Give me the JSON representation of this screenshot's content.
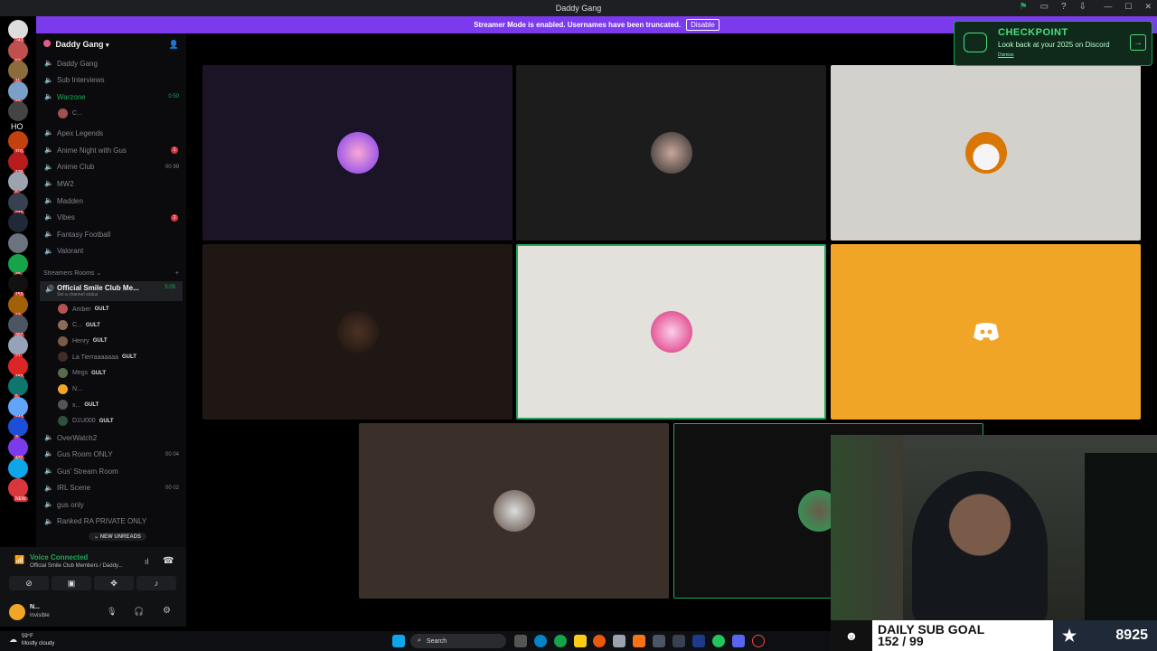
{
  "titlebar": {
    "title": "Daddy Gang"
  },
  "banner": {
    "text": "Streamer Mode is enabled. Usernames have been truncated.",
    "button": "Disable"
  },
  "servers": [
    {
      "badge": "243"
    },
    {
      "badge": "52"
    },
    {
      "badge": "11"
    },
    {
      "badge": "32"
    },
    {
      "badge": ""
    },
    {
      "badge": "110"
    },
    {
      "badge": "176"
    },
    {
      "badge": "6"
    },
    {
      "badge": "242"
    },
    {
      "badge": ""
    },
    {
      "badge": ""
    },
    {
      "badge": "49"
    },
    {
      "badge": "153"
    },
    {
      "badge": "13"
    },
    {
      "badge": "307"
    },
    {
      "badge": "21"
    },
    {
      "badge": "182"
    },
    {
      "badge": "5"
    },
    {
      "badge": "347"
    },
    {
      "badge": "3"
    },
    {
      "badge": "437"
    },
    {
      "badge": ""
    },
    {
      "badge": "NEW"
    }
  ],
  "home_label": "HO",
  "guild": {
    "name": "Daddy Gang"
  },
  "channels_top": [
    {
      "name": "Daddy Gang",
      "right": ""
    },
    {
      "name": "Sub Interviews",
      "right": ""
    },
    {
      "name": "Warzone",
      "right": "0:50",
      "active": true
    }
  ],
  "warzone_user": "C...",
  "channels_mid": [
    {
      "name": "Apex Legends",
      "right": ""
    },
    {
      "name": "Anime Night with Gus",
      "dot": "1"
    },
    {
      "name": "Anime Club",
      "right": "00 99"
    },
    {
      "name": "MW2",
      "right": ""
    },
    {
      "name": "Madden",
      "right": ""
    },
    {
      "name": "Vibes",
      "dot": "2"
    },
    {
      "name": "Fantasy Football",
      "right": ""
    },
    {
      "name": "Valorant",
      "right": ""
    }
  ],
  "category": "Streamers Rooms",
  "active_channel": {
    "name": "Official Smile Club Me...",
    "time": "5:05",
    "status": "Set a channel status"
  },
  "members": [
    {
      "name": "Amber",
      "tag": "GULT"
    },
    {
      "name": "C...",
      "tag": "GULT"
    },
    {
      "name": "Henry",
      "tag": "GULT"
    },
    {
      "name": "La Tierraaaaaaa",
      "tag": "GULT"
    },
    {
      "name": "Megs",
      "tag": "GULT"
    },
    {
      "name": "N...",
      "tag": ""
    },
    {
      "name": "x...",
      "tag": "GULT"
    },
    {
      "name": "D1U000",
      "tag": "GULT"
    }
  ],
  "channels_bottom": [
    {
      "name": "OverWatch2",
      "right": ""
    },
    {
      "name": "Gus Room ONLY",
      "right": "00 04"
    },
    {
      "name": "Gus' Stream Room",
      "right": ""
    },
    {
      "name": "IRL Scene",
      "right": "00 02"
    },
    {
      "name": "gus only",
      "right": ""
    },
    {
      "name": "Ranked RA PRIVATE ONLY",
      "right": ""
    }
  ],
  "new_unreads": "NEW UNREADS",
  "voice": {
    "title": "Voice Connected",
    "sub": "Official Smile Club Members / Daddy...",
    "me_name": "N...",
    "me_status": "Invisible"
  },
  "checkpoint": {
    "title": "CHECKPOINT",
    "subtitle": "Look back at your 2025 on Discord",
    "dismiss": "Dismiss"
  },
  "subgoal": {
    "line1": "DAILY SUB GOAL",
    "line2": "152 / 99",
    "count": "8925"
  },
  "taskbar": {
    "temp": "59°F",
    "weather": "Mostly cloudy",
    "search": "Search"
  },
  "colors": {
    "accent": "#7c3aed",
    "online": "#23a55a",
    "discord_tile": "#f0a526"
  }
}
